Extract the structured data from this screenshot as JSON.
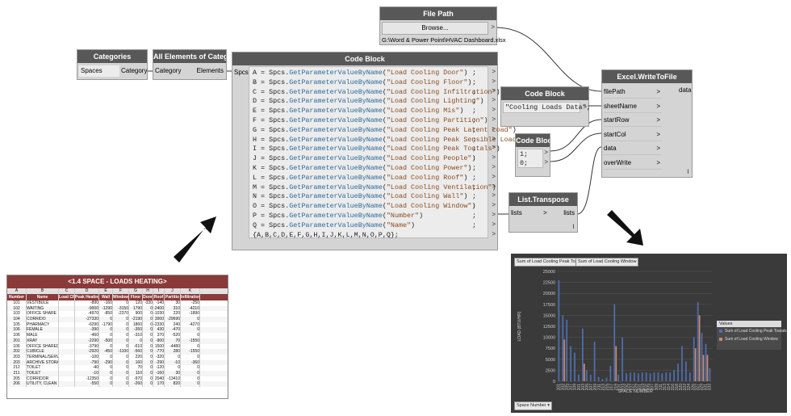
{
  "file_path_node": {
    "title": "File Path",
    "button": "Browse...",
    "value": "G:\\Word & Power Point\\HVAC Dashboard.xlsx"
  },
  "categories_node": {
    "title": "Categories",
    "selected": "Spaces",
    "output": "Category"
  },
  "all_elements_node": {
    "title": "All Elements of Category",
    "input": "Category",
    "output": "Elements"
  },
  "code_block_main": {
    "title": "Code Block",
    "input": "Spcs",
    "lines": [
      {
        "var": "A",
        "param": "\"Load Cooling Door\""
      },
      {
        "var": "B",
        "param": "\"Load Cooling Floor\""
      },
      {
        "var": "C",
        "param": "\"Load Cooling Infiltration\""
      },
      {
        "var": "D",
        "param": "\"Load Cooling Lighting\""
      },
      {
        "var": "E",
        "param": "\"Load Cooling Mis\""
      },
      {
        "var": "F",
        "param": "\"Load Cooling Partition\""
      },
      {
        "var": "G",
        "param": "\"Load Cooling Peak Latent Load\""
      },
      {
        "var": "H",
        "param": "\"Load Cooling Peak Sensible Load\""
      },
      {
        "var": "I",
        "param": "\"Load Cooling Peak Toatals\""
      },
      {
        "var": "J",
        "param": "\"Load Cooling People\""
      },
      {
        "var": "K",
        "param": "\"Load Cooling Power\""
      },
      {
        "var": "L",
        "param": "\"Load Cooling Roof\""
      },
      {
        "var": "M",
        "param": "\"Load Cooling Ventilation\""
      },
      {
        "var": "N",
        "param": "\"Load Cooling Wall\""
      },
      {
        "var": "O",
        "param": "\"Load Cooling Window\""
      },
      {
        "var": "P",
        "param": "\"Number\""
      },
      {
        "var": "Q",
        "param": "\"Name\""
      }
    ],
    "call_prefix": " = Spcs.",
    "call_fn": "GetParameterValueByName",
    "final_line": "{A,B,C,D,E,F,G,H,I,J,K,L,M,N,O,P,Q};",
    "semicolon": ";",
    "out": ">"
  },
  "code_block_sheet": {
    "title": "Code Block",
    "code": "\"Cooling Loads Data\";",
    "out": ">"
  },
  "code_block_nums": {
    "title": "Code Block",
    "line1": "1;",
    "line2": "0;",
    "out": ">"
  },
  "transpose_node": {
    "title": "List.Transpose",
    "input": "lists",
    "output": "lists",
    "footer": "l"
  },
  "excel_node": {
    "title": "Excel.WriteToFile",
    "inputs": [
      "filePath",
      "sheetName",
      "startRow",
      "startCol",
      "data",
      "overWrite"
    ],
    "output": "data",
    "footer": "l"
  },
  "spreadsheet": {
    "title": "<1.4 SPACE - LOADS HEATING>",
    "col_letters": [
      "A",
      "B",
      "C",
      "D",
      "E",
      "F",
      "G",
      "H",
      "I",
      "J",
      "K"
    ],
    "headers": [
      "Number",
      "Name",
      "Load CF",
      "Peak Heating",
      "Wall",
      "Window",
      "Floor",
      "Door",
      "Roof",
      "Partitio",
      "Infiltration"
    ],
    "rows": [
      [
        "101",
        "VESTIBULE",
        "",
        "-890",
        "-160",
        "0",
        "120",
        "-330",
        "-140",
        "30",
        "-250"
      ],
      [
        "102",
        "WAITING",
        "",
        "-9000",
        "-1290",
        "-3150",
        "1790",
        "0",
        "-2400",
        "310",
        "-4210"
      ],
      [
        "103",
        "OFFICE SHARE",
        "",
        "-4970",
        "-850",
        "-2370",
        "900",
        "0",
        "-1030",
        "220",
        "-1890"
      ],
      [
        "104",
        "CORRIDO",
        "",
        "-27330",
        "0",
        "0",
        "-2190",
        "0",
        "3000",
        "-29690",
        "0"
      ],
      [
        "105",
        "PHARMACY",
        "",
        "-6290",
        "-1790",
        "0",
        "1860",
        "0",
        "-2330",
        "240",
        "-4270"
      ],
      [
        "106",
        "FEMALE",
        "",
        "-390",
        "0",
        "0",
        "-350",
        "0",
        "430",
        "-470",
        "0"
      ],
      [
        "106",
        "MALE",
        "",
        "-460",
        "0",
        "0",
        "-310",
        "0",
        "370",
        "-520",
        "0"
      ],
      [
        "201",
        "XRAY",
        "",
        "-2290",
        "-500",
        "0",
        "0",
        "0",
        "-900",
        "70",
        "-1550"
      ],
      [
        "106",
        "OFFICE SHARED",
        "",
        "-3790",
        "0",
        "0",
        "-610",
        "0",
        "1500",
        "-4480",
        "0"
      ],
      [
        "202",
        "CUBICLE",
        "",
        "-2920",
        "-450",
        "-1100",
        "-560",
        "0",
        "-770",
        "280",
        "-1550"
      ],
      [
        "203",
        "TERMINAL/SERVE",
        "",
        "-100",
        "0",
        "0",
        "220",
        "0",
        "-320",
        "0",
        "0"
      ],
      [
        "203",
        "ARCHIVE STORAG",
        "",
        "-790",
        "-290",
        "0",
        "160",
        "0",
        "-290",
        "-10",
        "-360"
      ],
      [
        "212",
        "TOILET",
        "",
        "-40",
        "0",
        "0",
        "70",
        "0",
        "-120",
        "0",
        "0"
      ],
      [
        "211",
        "TOILET",
        "",
        "-10",
        "0",
        "0",
        "110",
        "0",
        "-160",
        "30",
        "0"
      ],
      [
        "205",
        "CORRIDOR",
        "",
        "-12350",
        "0",
        "0",
        "-970",
        "0",
        "2040",
        "-13410",
        "0"
      ],
      [
        "206",
        "UTILITY, CLEAN",
        "",
        "-550",
        "0",
        "0",
        "-260",
        "0",
        "170",
        "820",
        "0"
      ]
    ]
  },
  "chart_data": {
    "type": "bar",
    "title": "",
    "field_buttons": [
      "Sum of Load Cooling Peak Toatals",
      "Sum of Load Cooling Window"
    ],
    "filter_button": "Space Number",
    "xlabel": "SPACE NUMBER",
    "ylabel": "LOAD (BTU/HR)",
    "ylim": [
      0,
      25000
    ],
    "yticks": [
      "0",
      "2500",
      "5000",
      "7500",
      "10000",
      "12500",
      "15000",
      "17500",
      "20000",
      "22500",
      "25000"
    ],
    "categories": [
      "101",
      "103",
      "105",
      "106",
      "201",
      "203",
      "211",
      "203",
      "206",
      "207",
      "209",
      "211",
      "213",
      "215",
      "217",
      "219",
      "221",
      "223",
      "225",
      "227",
      "229",
      "301",
      "303",
      "305",
      "307",
      "309",
      "311",
      "313",
      "314",
      "316",
      "318",
      "320",
      "322",
      "324",
      "326",
      "327",
      "329",
      "331",
      "333"
    ],
    "xtick_labels": [
      "101",
      "103",
      "105",
      "107",
      "109",
      "201",
      "203",
      "205",
      "207",
      "209",
      "211",
      "213",
      "215",
      "217",
      "219",
      "221",
      "223",
      "225",
      "227",
      "229",
      "301",
      "303",
      "305",
      "307",
      "309",
      "311",
      "313",
      "314",
      "316",
      "318",
      "320",
      "322",
      "324",
      "326",
      "327",
      "329",
      "331",
      "333"
    ],
    "series": [
      {
        "name": "Sum of Load Cooling Peak Toatals",
        "color": "#4f6fb0",
        "values": [
          23000,
          15000,
          14000,
          8000,
          6500,
          1500,
          12000,
          2500,
          1500,
          9000,
          1000,
          500,
          800,
          3500,
          17500,
          1500,
          10000,
          1800,
          2000,
          2000,
          1800,
          2000,
          2000,
          1800,
          2000,
          2000,
          1800,
          2000,
          2000,
          2500,
          4000,
          8000,
          4500,
          2000,
          10000,
          18000,
          11000,
          8500,
          3000
        ]
      },
      {
        "name": "Sum of Load Cooling Window",
        "color": "#c98a6a",
        "values": [
          0,
          9500,
          0,
          0,
          0,
          0,
          4000,
          0,
          0,
          0,
          0,
          0,
          0,
          0,
          8000,
          0,
          0,
          0,
          0,
          0,
          0,
          0,
          0,
          0,
          0,
          0,
          0,
          0,
          0,
          0,
          0,
          0,
          0,
          0,
          7500,
          15000,
          6000,
          6000,
          0
        ]
      }
    ],
    "legend_title": "Values",
    "legend": "right",
    "grid": true
  },
  "colors": {
    "node_header": "#585858",
    "node_body": "#d4d4d4",
    "sheet_header": "#8b3a3a",
    "chart_bg": "#3a3a3a"
  }
}
